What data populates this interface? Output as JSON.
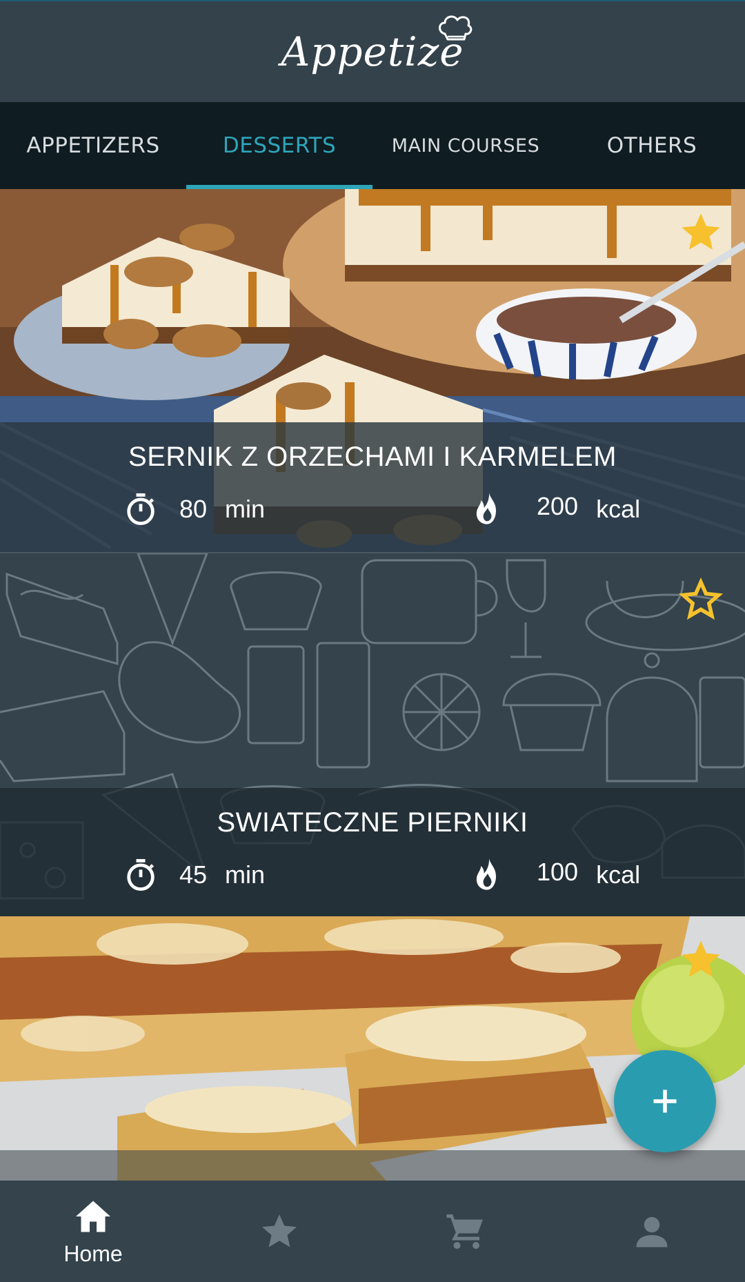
{
  "header": {
    "app_name": "Appetize"
  },
  "tabs": [
    {
      "label": "APPETIZERS",
      "active": false
    },
    {
      "label": "DESSERTS",
      "active": true
    },
    {
      "label": "MAIN COURSES",
      "active": false
    },
    {
      "label": "OTHERS",
      "active": false
    }
  ],
  "recipes": [
    {
      "title": "SERNIK Z ORZECHAMI I KARMELEM",
      "time": "80",
      "time_unit": "min",
      "calories": "200",
      "calories_unit": "kcal",
      "favorite": true
    },
    {
      "title": "SWIATECZNE PIERNIKI",
      "time": "45",
      "time_unit": "min",
      "calories": "100",
      "calories_unit": "kcal",
      "favorite": false
    },
    {
      "title": "",
      "favorite": true
    }
  ],
  "bottom_nav": {
    "items": [
      {
        "label": "Home",
        "icon": "home-icon",
        "active": true
      },
      {
        "label": "",
        "icon": "star-icon",
        "active": false
      },
      {
        "label": "",
        "icon": "cart-icon",
        "active": false
      },
      {
        "label": "",
        "icon": "person-icon",
        "active": false
      }
    ]
  },
  "colors": {
    "accent": "#2ea6b9",
    "star": "#f6c12c",
    "header_bg": "#33424b",
    "tab_bg": "#0f1c22"
  }
}
